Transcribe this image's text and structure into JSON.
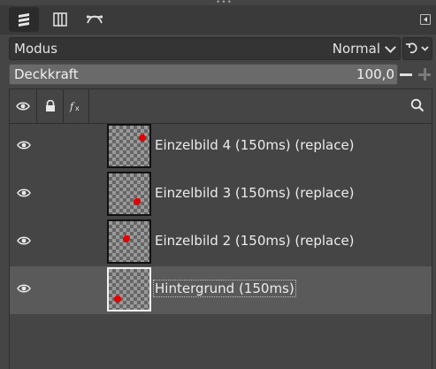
{
  "tabs": [
    {
      "name": "layers-tab",
      "icon": "layers-icon",
      "active": true
    },
    {
      "name": "channels-tab",
      "icon": "channels-icon",
      "active": false
    },
    {
      "name": "paths-tab",
      "icon": "paths-icon",
      "active": false
    }
  ],
  "mode": {
    "label": "Modus",
    "value": "Normal"
  },
  "opacity": {
    "label": "Deckkraft",
    "value": "100,0",
    "percent": 100
  },
  "header_icons": [
    "eye-icon",
    "lock-icon",
    "fx-icon",
    "search-icon"
  ],
  "layers": [
    {
      "name": "Einzelbild 4 (150ms) (replace)",
      "visible": true,
      "selected": false
    },
    {
      "name": "Einzelbild 3 (150ms) (replace)",
      "visible": true,
      "selected": false
    },
    {
      "name": "Einzelbild 2 (150ms) (replace)",
      "visible": true,
      "selected": false
    },
    {
      "name": "Hintergrund (150ms)",
      "visible": true,
      "selected": true
    }
  ],
  "colors": {
    "background": "#454545",
    "selected_row": "#5a5a5a",
    "dot": "#e40000"
  }
}
